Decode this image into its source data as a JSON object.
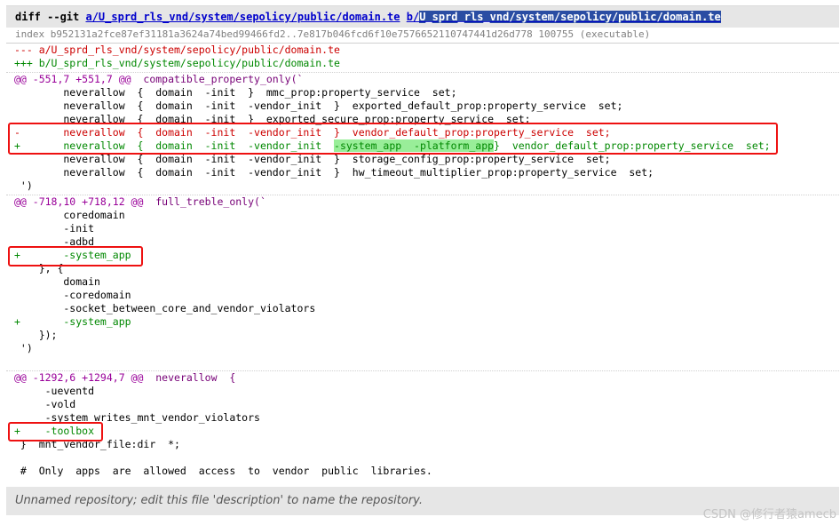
{
  "header": {
    "diff_cmd": "diff --git ",
    "link_a": "a/U_sprd_rls_vnd/system/sepolicy/public/domain.te",
    "space": " ",
    "link_b_prefix": "b/",
    "link_b_selected": "U_sprd_rls_vnd/system/sepolicy/public/domain.te"
  },
  "extended": {
    "index_line": "index b952131a2fce87ef31181a3624a74bed99466fd2..7e817b046fcd6f10e7576652110747441d26d778 100755 (executable)"
  },
  "file_header": {
    "from_line": "--- a/U_sprd_rls_vnd/system/sepolicy/public/domain.te",
    "to_line": "+++ b/U_sprd_rls_vnd/system/sepolicy/public/domain.te"
  },
  "chunk1": {
    "header": "@@ -551,7 +551,7 @@",
    "section": "  compatible_property_only(`",
    "lines": [
      "        neverallow  {  domain  -init  }  mmc_prop:property_service  set;",
      "        neverallow  {  domain  -init  -vendor_init  }  exported_default_prop:property_service  set;",
      "        neverallow  {  domain  -init  }  exported_secure_prop:property_service  set;"
    ],
    "removed": "-       neverallow  {  domain  -init  -vendor_init  }  vendor_default_prop:property_service  set;",
    "added_pre": "+       neverallow  {  domain  -init  -vendor_init  ",
    "added_hl": "-system_app  -platform_app",
    "added_post": "}  vendor_default_prop:property_service  set;",
    "after": [
      "        neverallow  {  domain  -init  -vendor_init  }  storage_config_prop:property_service  set;",
      "        neverallow  {  domain  -init  -vendor_init  }  hw_timeout_multiplier_prop:property_service  set;",
      " ')"
    ]
  },
  "chunk2": {
    "header": "@@ -718,10 +718,12 @@",
    "section": "  full_treble_only(`",
    "lines_a": [
      "        coredomain",
      "        -init",
      "        -adbd"
    ],
    "added1": "+       -system_app",
    "lines_b": [
      "    }, {",
      "        domain",
      "        -coredomain",
      "        -socket_between_core_and_vendor_violators"
    ],
    "added2": "+       -system_app",
    "lines_c": [
      "    });",
      " ')"
    ]
  },
  "chunk3": {
    "header": "@@ -1292,6 +1294,7 @@",
    "section": "  neverallow  {",
    "lines_a": [
      "     -ueventd",
      "     -vold",
      "     -system_writes_mnt_vendor_violators"
    ],
    "added": "+    -toolbox",
    "lines_b": [
      " }  mnt_vendor_file:dir  *;",
      "",
      " #  Only  apps  are  allowed  access  to  vendor  public  libraries."
    ]
  },
  "footer": {
    "description": "Unnamed repository; edit this file 'description' to name the repository."
  },
  "watermark": "CSDN @修行者猿amecb",
  "colors": {
    "removed": "#cc0000",
    "added": "#008800",
    "chunk_header": "#990099",
    "highlight_box": "#ee1111",
    "added_highlight_bg": "#99ee99"
  }
}
